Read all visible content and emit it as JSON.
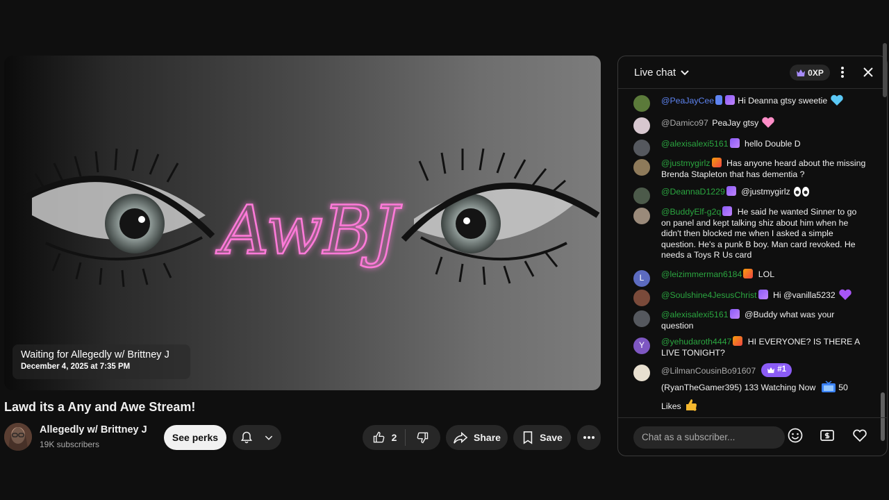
{
  "player": {
    "logo_text": "AwBJ",
    "waiting_title": "Waiting for Allegedly w/ Brittney J",
    "waiting_date": "December 4, 2025 at 7:35 PM"
  },
  "video": {
    "title": "Lawd its a Any and Awe Stream!",
    "channel_name": "Allegedly w/ Brittney J",
    "subscribers": "19K subscribers",
    "perks_label": "See perks",
    "like_count": "2",
    "share_label": "Share",
    "save_label": "Save"
  },
  "chat": {
    "title": "Live chat",
    "xp_label": "0XP",
    "input_placeholder": "Chat as a subscriber...",
    "messages": [
      {
        "author": "@PeaJayCee",
        "text": "Hi Deanna gtsy sweetie"
      },
      {
        "author": "@Damico97",
        "text": "PeaJay gtsy"
      },
      {
        "author": "@alexisalexi5161",
        "text": "hello Double D"
      },
      {
        "author": "@justmygirlz",
        "text": "Has anyone heard about the missing Brenda Stapleton that has dementia ?"
      },
      {
        "author": "@DeannaD1229",
        "text": "@justmygirlz"
      },
      {
        "author": "@BuddyElf-g2q",
        "text": "He said he wanted Sinner to go on panel and kept talking shiz about him when he didn't then blocked me when I asked a simple question. He's a punk B boy. Man card revoked. He needs a Toys R Us card"
      },
      {
        "author": "@leizimmerman6184",
        "text": "LOL",
        "avatar_letter": "L"
      },
      {
        "author": "@Soulshine4JesusChrist",
        "text": "Hi @vanilla5232"
      },
      {
        "author": "@alexisalexi5161",
        "text": "@Buddy what was your question"
      },
      {
        "author": "@yehudaroth4447",
        "text": "HI EVERYONE? IS THERE A LIVE TONIGHT?",
        "avatar_letter": "Y"
      },
      {
        "author": "@LilmanCousinBo91607",
        "rank": "#1",
        "text": "(RyanTheGamer395) 133 Watching Now",
        "text2": "50",
        "text3": "Likes"
      }
    ]
  },
  "colors": {
    "background": "#0f0f0f",
    "author_green": "#2ba640",
    "author_blue": "#5e84f1",
    "accent_purple": "#8b5cf6",
    "neon_pink": "#ff6fd8"
  }
}
